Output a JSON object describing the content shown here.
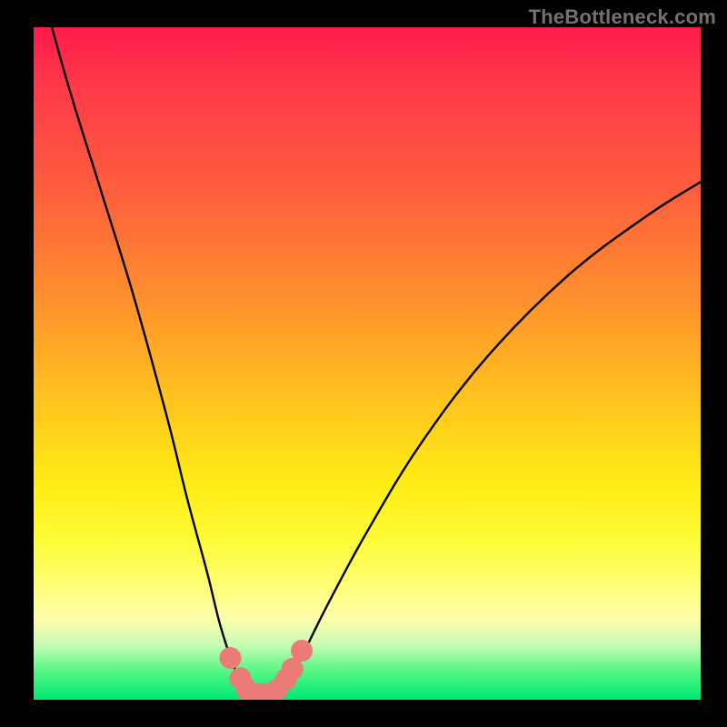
{
  "watermark": "TheBottleneck.com",
  "chart_data": {
    "type": "line",
    "title": "",
    "xlabel": "",
    "ylabel": "",
    "xlim": [
      0,
      100
    ],
    "ylim": [
      0,
      100
    ],
    "series": [
      {
        "name": "bottleneck-curve",
        "x": [
          0,
          5,
          10,
          15,
          20,
          23,
          26,
          28,
          30,
          31.5,
          33,
          34.5,
          36,
          38,
          40,
          44,
          50,
          58,
          68,
          80,
          92,
          100
        ],
        "values": [
          110,
          92,
          76,
          60,
          42,
          30,
          19,
          11,
          5,
          2,
          0.5,
          0,
          0.5,
          2.5,
          6,
          14,
          25,
          38,
          51,
          63,
          72,
          77
        ]
      }
    ],
    "markers": {
      "name": "highlighted-points",
      "x": [
        29.5,
        31,
        32,
        33,
        34,
        35,
        36.5,
        37.8,
        38.8,
        40.2
      ],
      "values": [
        6.2,
        3.2,
        1.5,
        0.8,
        0.8,
        0.8,
        1.5,
        3.0,
        4.6,
        7.3
      ],
      "color": "#eb7b76",
      "radius": 12
    },
    "gradient_colors": {
      "top": "#ff1a4a",
      "mid_upper": "#ff8f2e",
      "mid": "#ffed15",
      "pale": "#fdfdad",
      "green": "#00e876"
    }
  }
}
